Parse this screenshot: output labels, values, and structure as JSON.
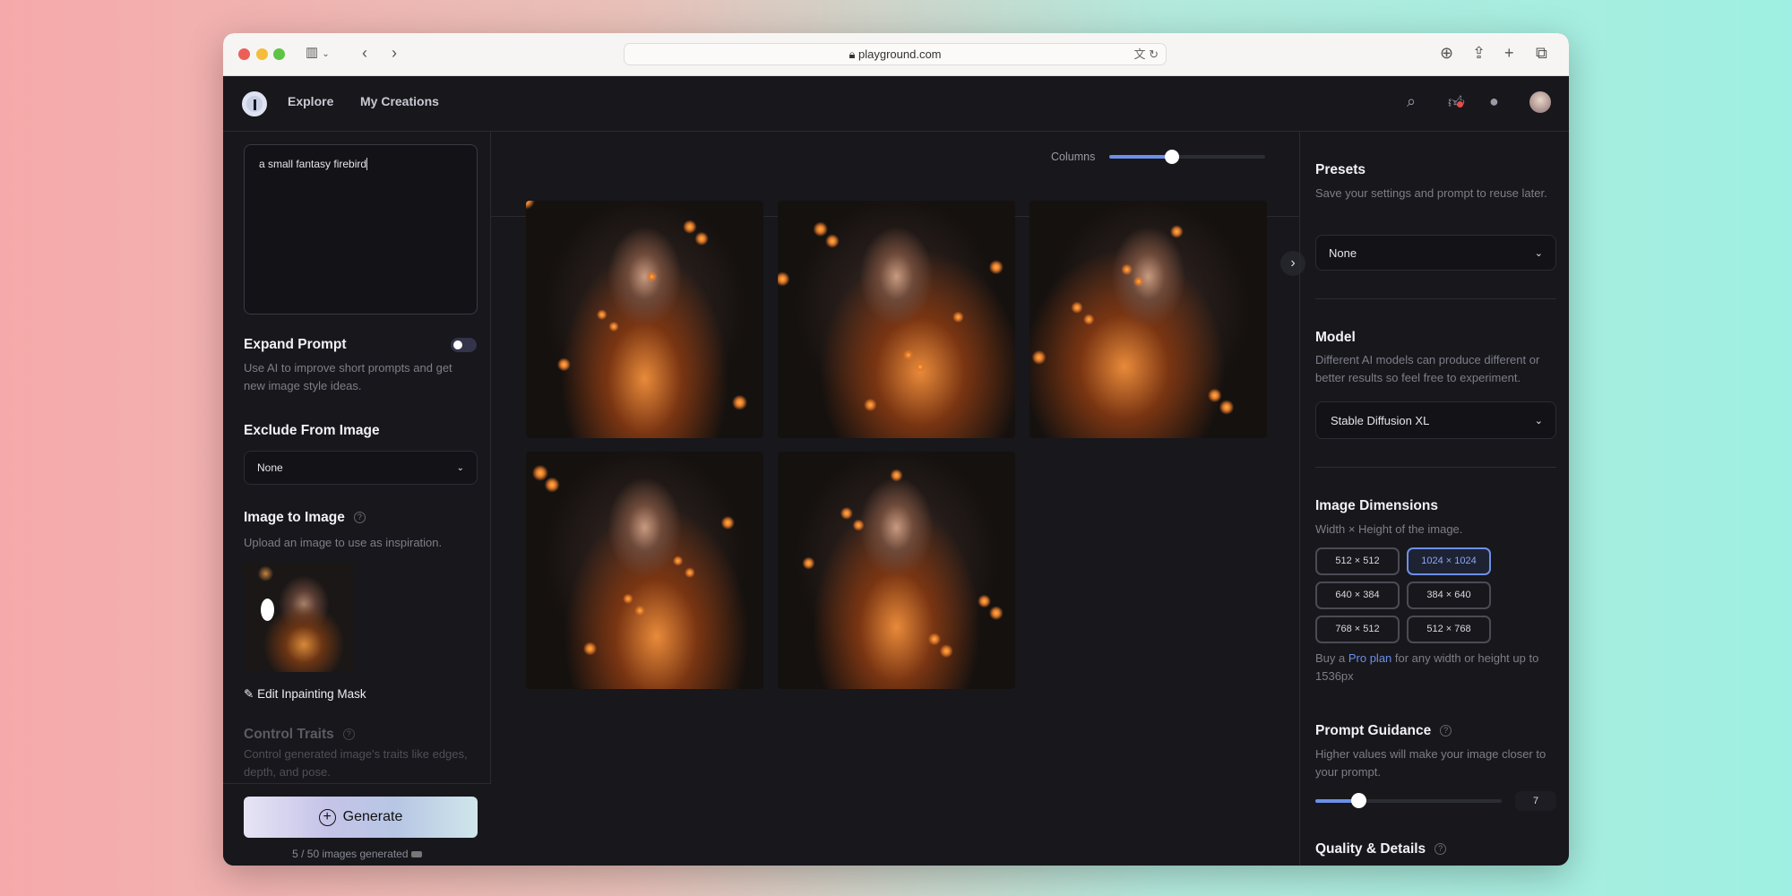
{
  "browser": {
    "url": "playground.com",
    "icons": [
      "sidebar-icon",
      "back-icon",
      "forward-icon",
      "translate-icon",
      "reload-icon",
      "download-icon",
      "share-icon",
      "new-tab-icon",
      "tabs-icon"
    ]
  },
  "header": {
    "nav": [
      "Explore",
      "My Creations"
    ],
    "icons": [
      "search-icon",
      "like-icon",
      "chat-icon",
      "avatar"
    ]
  },
  "left": {
    "prompt": "a small fantasy firebird",
    "expand_title": "Expand Prompt",
    "expand_desc": "Use AI to improve short prompts and get new image style ideas.",
    "expand_on": false,
    "exclude_title": "Exclude From Image",
    "exclude_value": "None",
    "i2i_title": "Image to Image",
    "i2i_desc": "Upload an image to use as inspiration.",
    "edit_mask": "Edit Inpainting Mask",
    "traits_title": "Control Traits",
    "traits_desc": "Control generated image's traits like edges, depth, and pose.",
    "generate": "Generate",
    "count": "5 / 50 images generated"
  },
  "main": {
    "columns_label": "Columns",
    "columns_level": 0.4,
    "image_count": 5
  },
  "right": {
    "presets_title": "Presets",
    "presets_desc": "Save your settings and prompt to reuse later.",
    "presets_value": "None",
    "model_title": "Model",
    "model_desc": "Different AI models can produce different or better results so feel free to experiment.",
    "model_value": "Stable Diffusion XL",
    "dims_title": "Image Dimensions",
    "dims_desc": "Width × Height of the image.",
    "dims": [
      "512 × 512",
      "1024 × 1024",
      "640 × 384",
      "384 × 640",
      "768 × 512",
      "512 × 768"
    ],
    "dims_selected": "1024 × 1024",
    "pro_pre": "Buy a ",
    "pro_link": "Pro plan",
    "pro_post": " for any width or height up to 1536px",
    "guidance_title": "Prompt Guidance",
    "guidance_desc": "Higher values will make your image closer to your prompt.",
    "guidance_value": "7",
    "quality_title": "Quality & Details"
  },
  "colors": {
    "accent": "#6d8fe8",
    "bg": "#17171c"
  }
}
